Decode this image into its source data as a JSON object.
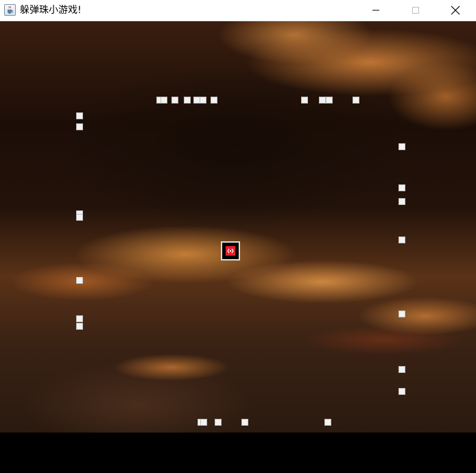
{
  "window": {
    "title": "躲弹珠小游戏!",
    "icon": "java-coffee-cup-icon",
    "controls": [
      "minimize-icon",
      "maximize-icon",
      "close-icon"
    ]
  },
  "game": {
    "background": "sunset-cloud-sky",
    "player": {
      "icon": "red-ball-player-icon",
      "color": "#e3202a"
    },
    "bullet_color": "#f2f2f2",
    "bullet_count": 35
  }
}
